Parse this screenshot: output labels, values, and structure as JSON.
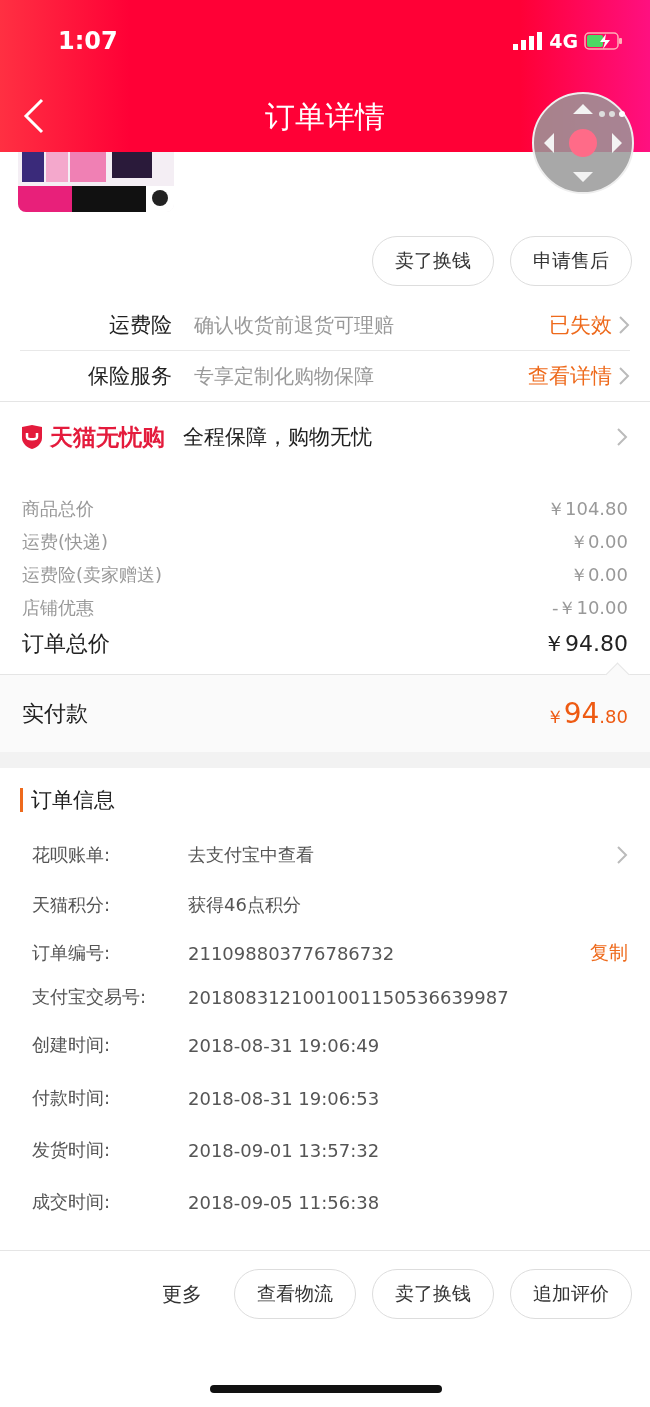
{
  "status_bar": {
    "time": "1:07",
    "network": "4G"
  },
  "nav": {
    "title": "订单详情"
  },
  "product": {
    "kind": "picture"
  },
  "item_buttons": [
    "卖了换钱",
    "申请售后"
  ],
  "services": [
    {
      "label": "运费险",
      "desc": "确认收货前退货可理赔",
      "action": "已失效"
    },
    {
      "label": "保险服务",
      "desc": "专享定制化购物保障",
      "action": "查看详情"
    }
  ],
  "guarantee": {
    "brand": "天猫无忧购",
    "text": "全程保障，购物无忧"
  },
  "fees": [
    {
      "label": "商品总价",
      "value": "￥104.80"
    },
    {
      "label": "运费(快递)",
      "value": "￥0.00"
    },
    {
      "label": "运费险(卖家赠送)",
      "value": "￥0.00"
    },
    {
      "label": "店铺优惠",
      "value": "-￥10.00"
    }
  ],
  "total": {
    "label": "订单总价",
    "value": "￥94.80"
  },
  "paid": {
    "label": "实付款",
    "currency": "￥",
    "integer": "94",
    "decimal": ".80"
  },
  "order_info": {
    "title": "订单信息",
    "rows": [
      {
        "label": "花呗账单:",
        "value": "去支付宝中查看",
        "kind": "link"
      },
      {
        "label": "天猫积分:",
        "value": "获得46点积分",
        "kind": "plain"
      },
      {
        "label": "订单编号:",
        "value": "211098803776786732",
        "kind": "copy",
        "action": "复制"
      },
      {
        "label": "支付宝交易号:",
        "value": "2018083121001001150536639987",
        "kind": "plain"
      },
      {
        "label": "创建时间:",
        "value": "2018-08-31 19:06:49",
        "kind": "plain"
      },
      {
        "label": "付款时间:",
        "value": "2018-08-31 19:06:53",
        "kind": "plain"
      },
      {
        "label": "发货时间:",
        "value": "2018-09-01 13:57:32",
        "kind": "plain"
      },
      {
        "label": "成交时间:",
        "value": "2018-09-05 11:56:38",
        "kind": "plain"
      }
    ]
  },
  "bottom_bar": {
    "more": "更多",
    "buttons": [
      "查看物流",
      "卖了换钱",
      "追加评价"
    ]
  }
}
